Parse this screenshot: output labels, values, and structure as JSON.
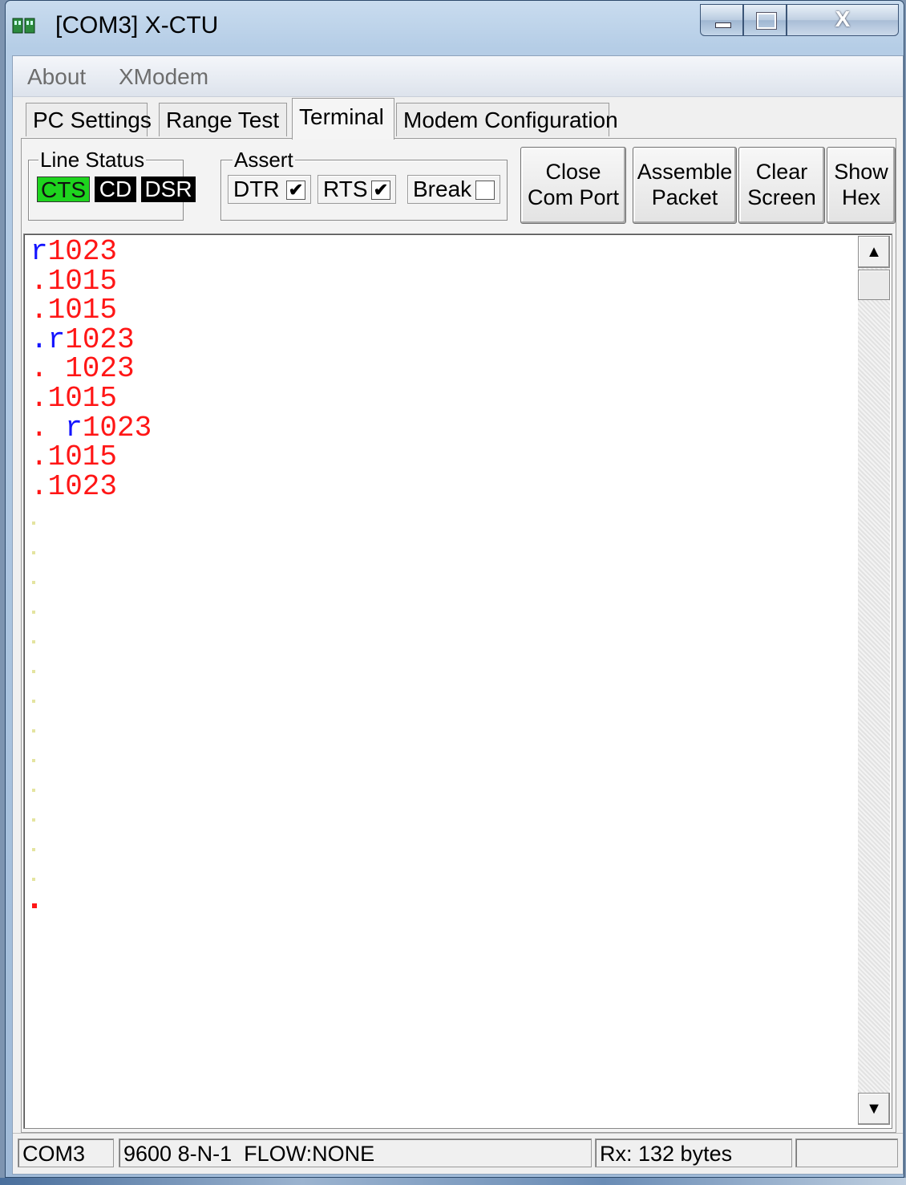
{
  "window": {
    "title": "[COM3] X-CTU",
    "close_glyph": "X"
  },
  "menu": [
    "About",
    "XModem"
  ],
  "tabs": [
    {
      "label": "PC Settings",
      "active": false
    },
    {
      "label": "Range Test",
      "active": false
    },
    {
      "label": "Terminal",
      "active": true
    },
    {
      "label": "Modem Configuration",
      "active": false
    }
  ],
  "line_status": {
    "label": "Line Status",
    "indicators": [
      {
        "label": "CTS",
        "state": "on",
        "color": "#1ed41e"
      },
      {
        "label": "CD",
        "state": "off",
        "color": "#000000"
      },
      {
        "label": "DSR",
        "state": "off",
        "color": "#000000"
      }
    ]
  },
  "assert": {
    "label": "Assert",
    "checks": [
      {
        "label": "DTR",
        "checked": true
      },
      {
        "label": "RTS",
        "checked": true
      },
      {
        "label": "Break",
        "checked": false
      }
    ]
  },
  "buttons": {
    "close_port": [
      "Close",
      "Com Port"
    ],
    "assemble": [
      "Assemble",
      "Packet"
    ],
    "clear": [
      "Clear",
      "Screen"
    ],
    "show_hex": [
      "Show",
      "Hex"
    ]
  },
  "terminal": {
    "colors": {
      "sent": "#1414ff",
      "received": "#ff1616"
    },
    "lines": [
      [
        {
          "t": "r",
          "c": "b"
        },
        {
          "t": "1023",
          "c": "r"
        }
      ],
      [
        {
          "t": ".1015",
          "c": "r"
        }
      ],
      [
        {
          "t": ".1015",
          "c": "r"
        }
      ],
      [
        {
          "t": ".r",
          "c": "b"
        },
        {
          "t": "1023",
          "c": "r"
        }
      ],
      [
        {
          "t": ". 1023",
          "c": "r"
        }
      ],
      [
        {
          "t": ".1015",
          "c": "r"
        }
      ],
      [
        {
          "t": ". ",
          "c": "r"
        },
        {
          "t": "r",
          "c": "b"
        },
        {
          "t": "1023",
          "c": "r"
        }
      ],
      [
        {
          "t": ".1015",
          "c": "r"
        }
      ],
      [
        {
          "t": ".1023",
          "c": "r"
        }
      ]
    ]
  },
  "scrollbar": {
    "up_glyph": "▲",
    "down_glyph": "▼"
  },
  "status": {
    "port": "COM3",
    "settings": "9600 8-N-1  FLOW:NONE",
    "rx": "Rx: 132 bytes",
    "extra": ""
  },
  "icons": {
    "app": "xctu-modules-icon"
  }
}
